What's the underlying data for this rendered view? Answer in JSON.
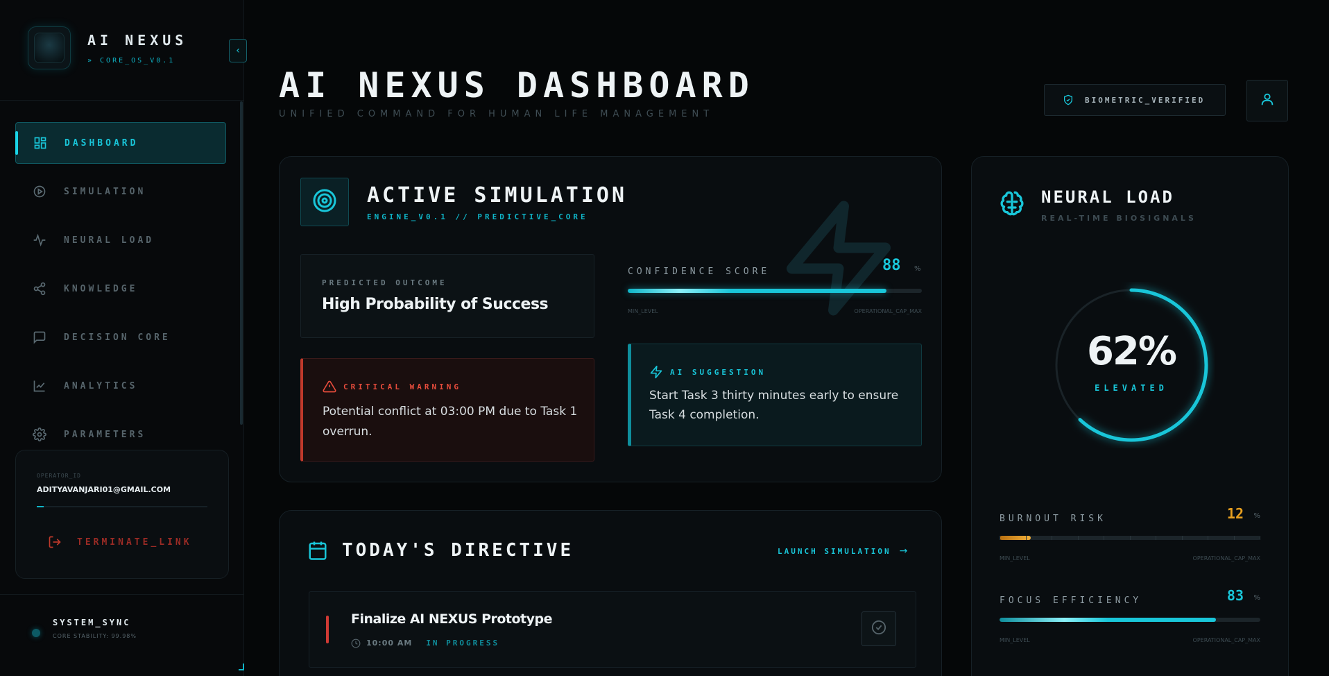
{
  "brand": {
    "title": "AI NEXUS",
    "subtitle": "» CORE_OS_V0.1"
  },
  "sidebar": {
    "items": [
      {
        "label": "DASHBOARD",
        "icon": "grid-icon",
        "active": true
      },
      {
        "label": "SIMULATION",
        "icon": "play-circle-icon"
      },
      {
        "label": "NEURAL LOAD",
        "icon": "activity-icon"
      },
      {
        "label": "KNOWLEDGE",
        "icon": "share-nodes-icon"
      },
      {
        "label": "DECISION CORE",
        "icon": "message-square-icon"
      },
      {
        "label": "ANALYTICS",
        "icon": "line-chart-icon"
      },
      {
        "label": "PARAMETERS",
        "icon": "gear-icon"
      }
    ],
    "operator": {
      "label": "OPERATOR_ID",
      "email": "ADITYAVANJARI01@GMAIL.COM",
      "terminate": "TERMINATE_LINK"
    },
    "sync": {
      "title": "SYSTEM_SYNC",
      "subtitle": "CORE STABILITY: 99.98%"
    }
  },
  "header": {
    "title": "AI NEXUS DASHBOARD",
    "subtitle": "UNIFIED COMMAND FOR HUMAN LIFE MANAGEMENT",
    "badge": "BIOMETRIC_VERIFIED"
  },
  "simulation": {
    "title": "ACTIVE SIMULATION",
    "subtitle": "ENGINE_V0.1 // PREDICTIVE_CORE",
    "outcome_label": "PREDICTED OUTCOME",
    "outcome_value": "High Probability of Success",
    "confidence_label": "CONFIDENCE SCORE",
    "confidence_value": "88",
    "confidence_unit": "%",
    "confidence_fraction": 0.88,
    "min_label": "MIN_LEVEL",
    "max_label": "OPERATIONAL_CAP_MAX",
    "warning_label": "CRITICAL WARNING",
    "warning_text": "Potential conflict at 03:00 PM due to Task 1 overrun.",
    "suggestion_label": "AI SUGGESTION",
    "suggestion_text": "Start Task 3 thirty minutes early to ensure Task 4 completion."
  },
  "directive": {
    "title": "TODAY'S DIRECTIVE",
    "launch": "LAUNCH SIMULATION",
    "task": {
      "title": "Finalize AI NEXUS Prototype",
      "time": "10:00 AM",
      "status": "IN PROGRESS"
    }
  },
  "neural": {
    "title": "NEURAL LOAD",
    "subtitle": "REAL-TIME BIOSIGNALS",
    "gauge_value": "62%",
    "gauge_fraction": 0.62,
    "gauge_state": "ELEVATED",
    "burnout": {
      "label": "BURNOUT RISK",
      "value": "12",
      "unit": "%",
      "fraction": 0.12,
      "min": "MIN_LEVEL",
      "max": "OPERATIONAL_CAP_MAX"
    },
    "focus": {
      "label": "FOCUS EFFICIENCY",
      "value": "83",
      "unit": "%",
      "fraction": 0.83,
      "min": "MIN_LEVEL",
      "max": "OPERATIONAL_CAP_MAX"
    }
  },
  "colors": {
    "accent": "#19c6d9",
    "warning": "#e74c3c",
    "burnout": "#e8a020"
  }
}
